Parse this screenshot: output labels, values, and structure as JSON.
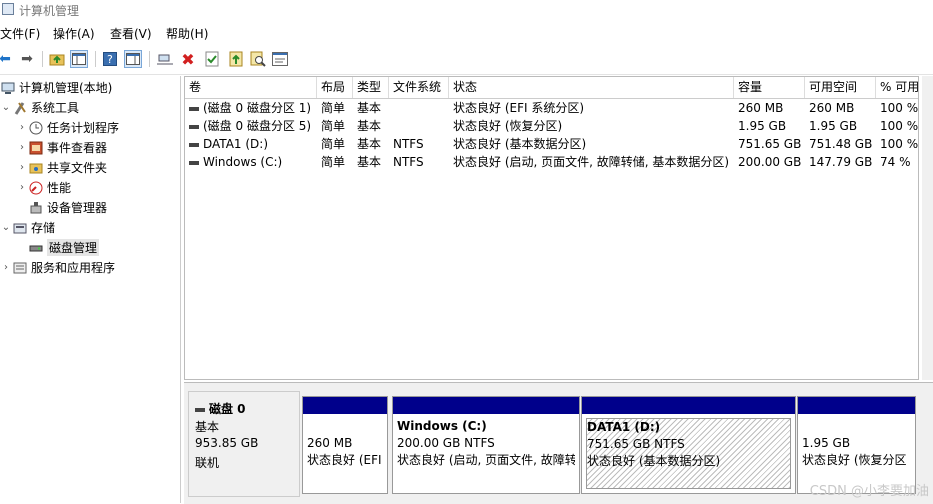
{
  "window": {
    "title": "计算机管理"
  },
  "menu": [
    "文件(F)",
    "操作(A)",
    "查看(V)",
    "帮助(H)"
  ],
  "toolbar_icons": [
    "back-arrow-icon",
    "forward-arrow-icon",
    "up-folder-icon",
    "show-hide-tree-icon",
    "help-icon",
    "help-topics-icon",
    "connect-icon",
    "delete-icon",
    "check-icon",
    "import-icon",
    "search-icon",
    "properties-icon"
  ],
  "tree": {
    "root": "计算机管理(本地)",
    "system_tools": "系统工具",
    "task_scheduler": "任务计划程序",
    "event_viewer": "事件查看器",
    "shared_folders": "共享文件夹",
    "performance": "性能",
    "device_manager": "设备管理器",
    "storage": "存储",
    "disk_management": "磁盘管理",
    "services_apps": "服务和应用程序"
  },
  "volumes": {
    "headers": [
      "卷",
      "布局",
      "类型",
      "文件系统",
      "状态",
      "容量",
      "可用空间",
      "% 可用"
    ],
    "rows": [
      [
        "(磁盘 0 磁盘分区 1)",
        "简单",
        "基本",
        "",
        "状态良好 (EFI 系统分区)",
        "260 MB",
        "260 MB",
        "100 %"
      ],
      [
        "(磁盘 0 磁盘分区 5)",
        "简单",
        "基本",
        "",
        "状态良好 (恢复分区)",
        "1.95 GB",
        "1.95 GB",
        "100 %"
      ],
      [
        "DATA1 (D:)",
        "简单",
        "基本",
        "NTFS",
        "状态良好 (基本数据分区)",
        "751.65 GB",
        "751.48 GB",
        "100 %"
      ],
      [
        "Windows (C:)",
        "简单",
        "基本",
        "NTFS",
        "状态良好 (启动, 页面文件, 故障转储, 基本数据分区)",
        "200.00 GB",
        "147.79 GB",
        "74 %"
      ]
    ]
  },
  "disk": {
    "name": "磁盘 0",
    "type": "基本",
    "size": "953.85 GB",
    "status": "联机",
    "partitions": [
      {
        "title": "",
        "size": "260 MB",
        "status": "状态良好 (EFI"
      },
      {
        "title": "Windows  (C:)",
        "size": "200.00 GB NTFS",
        "status": "状态良好 (启动, 页面文件, 故障转"
      },
      {
        "title": "DATA1  (D:)",
        "size": "751.65 GB NTFS",
        "status": "状态良好 (基本数据分区)"
      },
      {
        "title": "",
        "size": "1.95 GB",
        "status": "状态良好 (恢复分区"
      }
    ]
  },
  "watermark": "CSDN @小李要加油",
  "colors": {
    "partition_bar": "#00008b",
    "selection": "#e5e5e5"
  }
}
